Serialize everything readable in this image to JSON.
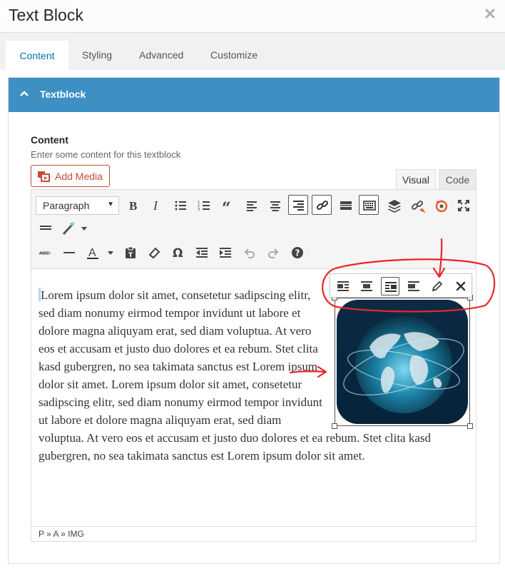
{
  "window": {
    "title": "Text Block",
    "close_icon": "close-icon"
  },
  "tabs": [
    {
      "label": "Content",
      "active": true
    },
    {
      "label": "Styling",
      "active": false
    },
    {
      "label": "Advanced",
      "active": false
    },
    {
      "label": "Customize",
      "active": false
    }
  ],
  "panel": {
    "title": "Textblock",
    "accent": "#3e8fc4"
  },
  "field": {
    "label": "Content",
    "description": "Enter some content for this textblock",
    "add_media_label": "Add Media"
  },
  "editor": {
    "tabs": {
      "visual": "Visual",
      "code": "Code"
    },
    "format_select": "Paragraph",
    "toolbar_row1": [
      "bold-icon",
      "italic-icon",
      "bullet-list-icon",
      "numbered-list-icon",
      "blockquote-icon",
      "align-left-icon",
      "align-center-icon",
      "align-right-icon",
      "link-icon",
      "read-more-icon",
      "toolbar-toggle-icon",
      "layers-icon",
      "unlink-icon",
      "refresh-icon",
      "fullscreen-icon"
    ],
    "toolbar_row2": [
      "horizontal-line-icon",
      "magic-wand-icon"
    ],
    "toolbar_row3": [
      "strikethrough-icon",
      "horizontal-rule-icon",
      "text-color-icon",
      "paste-text-icon",
      "clear-formatting-icon",
      "special-character-icon",
      "outdent-icon",
      "indent-icon",
      "undo-icon",
      "redo-icon",
      "help-icon"
    ],
    "image_toolbar": [
      "align-left-icon",
      "align-center-icon",
      "align-right-icon",
      "no-align-icon",
      "edit-icon",
      "remove-icon"
    ],
    "text": "Lorem ipsum dolor sit amet, consetetur sadipscing elitr, sed diam nonumy eirmod tempor invidunt ut labore et dolore magna aliquyam erat, sed diam voluptua. At vero eos et accusam et justo duo dolores et ea rebum. Stet clita kasd gubergren, no sea takimata sanctus est Lorem ipsum dolor sit amet. Lorem ipsum dolor sit amet, consetetur sadipscing elitr, sed diam nonumy eirmod tempor invidunt ut labore et dolore magna aliquyam erat, sed diam voluptua. At vero eos et accusam et justo duo dolores et ea rebum. Stet clita kasd gubergren, no sea takimata sanctus est Lorem ipsum dolor sit amet.",
    "image_icon": "globe-image",
    "path": "P » A » IMG"
  },
  "colors": {
    "annotation": "#e8262a",
    "link": "#0073aa",
    "media_button": "#c9493a"
  }
}
